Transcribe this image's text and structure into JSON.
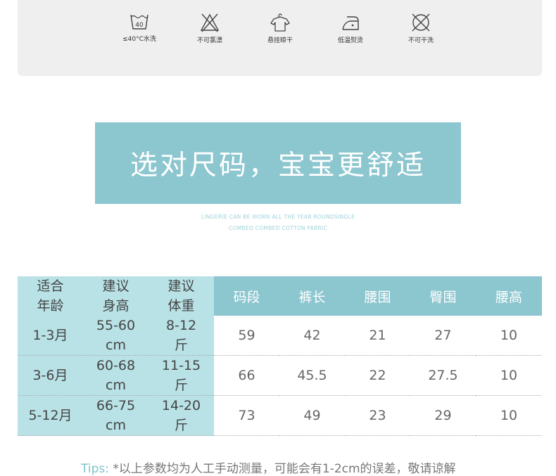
{
  "care": {
    "items": [
      {
        "icon": "wash-40-icon",
        "label": "≤40°C水洗",
        "temp": "40"
      },
      {
        "icon": "no-bleach-icon",
        "label": "不可氯漂"
      },
      {
        "icon": "hang-dry-icon",
        "label": "悬挂晾干"
      },
      {
        "icon": "low-iron-icon",
        "label": "低温熨烫"
      },
      {
        "icon": "no-dry-clean-icon",
        "label": "不可干洗"
      }
    ]
  },
  "banner": {
    "title": "选对尺码，宝宝更舒适",
    "sub1": "LINGERIE CAN BE WORN ALL THE YEAR ROUNDSINGLE",
    "sub2": "COMBED COMBED COTTON FABRIC"
  },
  "table": {
    "headers": [
      {
        "l1": "适合",
        "l2": "年龄"
      },
      {
        "l1": "建议",
        "l2": "身高"
      },
      {
        "l1": "建议",
        "l2": "体重"
      },
      {
        "l1": "码段"
      },
      {
        "l1": "裤长"
      },
      {
        "l1": "腰围"
      },
      {
        "l1": "臀围"
      },
      {
        "l1": "腰高"
      }
    ],
    "rows": [
      {
        "age": "1-3月",
        "height_l1": "55-60",
        "height_l2": "cm",
        "weight_l1": "8-12",
        "weight_l2": "斤",
        "vals": [
          "59",
          "42",
          "21",
          "27",
          "10"
        ]
      },
      {
        "age": "3-6月",
        "height_l1": "60-68",
        "height_l2": "cm",
        "weight_l1": "11-15",
        "weight_l2": "斤",
        "vals": [
          "66",
          "45.5",
          "22",
          "27.5",
          "10"
        ]
      },
      {
        "age": "5-12月",
        "height_l1": "66-75",
        "height_l2": "cm",
        "weight_l1": "14-20",
        "weight_l2": "斤",
        "vals": [
          "73",
          "49",
          "23",
          "29",
          "10"
        ]
      }
    ]
  },
  "tips": {
    "label": "Tips:",
    "text": "*以上参数均为人工手动测量，可能会有1-2cm的误差，敬请谅解"
  },
  "colors": {
    "accent": "#8cc6cf",
    "light_accent": "#b9e2e6",
    "panel": "#efefef"
  }
}
